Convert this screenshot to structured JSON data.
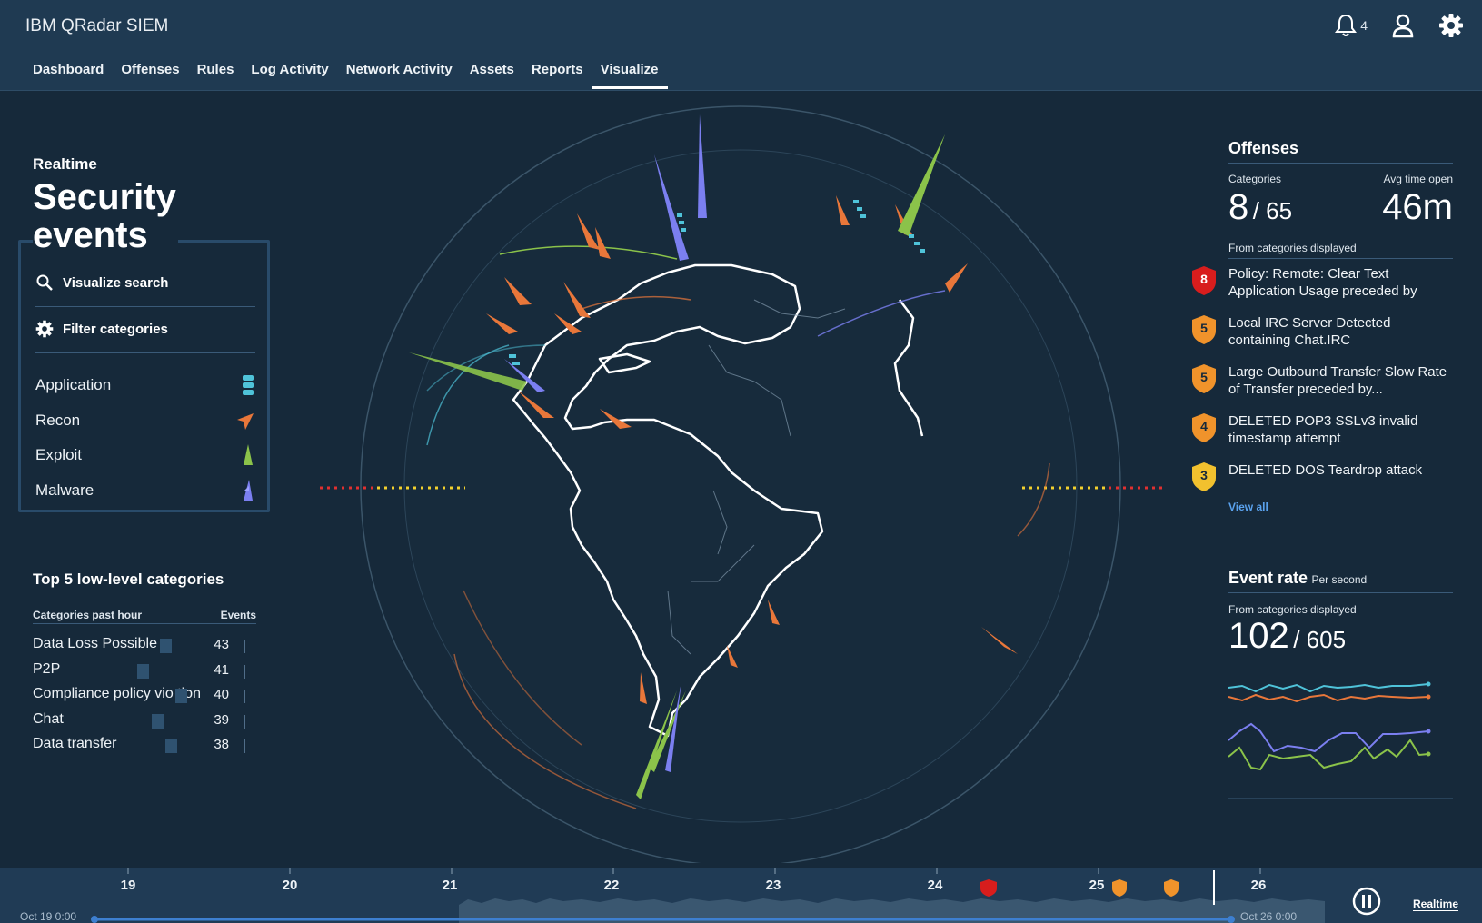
{
  "app": {
    "title": "IBM QRadar SIEM",
    "notification_count": "4"
  },
  "nav": {
    "items": [
      {
        "label": "Dashboard"
      },
      {
        "label": "Offenses"
      },
      {
        "label": "Rules"
      },
      {
        "label": "Log Activity"
      },
      {
        "label": "Network Activity"
      },
      {
        "label": "Assets"
      },
      {
        "label": "Reports"
      },
      {
        "label": "Visualize"
      }
    ],
    "active": "Visualize"
  },
  "left_panel": {
    "realtime_label": "Realtime",
    "title_line1": "Security",
    "title_line2": "events",
    "visualize_search": "Visualize search",
    "filter_categories": "Filter categories",
    "categories": [
      {
        "label": "Application",
        "icon": "application-cylinder-icon",
        "color": "#4fc3d9"
      },
      {
        "label": "Recon",
        "icon": "recon-arrow-icon",
        "color": "#e9773a"
      },
      {
        "label": "Exploit",
        "icon": "exploit-spike-icon",
        "color": "#8bc34a"
      },
      {
        "label": "Malware",
        "icon": "malware-spike-icon",
        "color": "#7b7ff0"
      }
    ]
  },
  "top5": {
    "title": "Top 5 low-level categories",
    "col_category": "Categories past hour",
    "col_events": "Events",
    "rows": [
      {
        "label": "Data Loss Possible",
        "events": "43"
      },
      {
        "label": "P2P",
        "events": "41"
      },
      {
        "label": "Compliance policy vio  tion",
        "events": "40"
      },
      {
        "label": "Chat",
        "events": "39"
      },
      {
        "label": "Data transfer",
        "events": "38"
      }
    ]
  },
  "offenses": {
    "title": "Offenses",
    "categories_label": "Categories",
    "categories_value": "8",
    "categories_total": "/ 65",
    "avg_label": "Avg time open",
    "avg_value": "46m",
    "from_label": "From categories displayed",
    "items": [
      {
        "severity": "8",
        "color": "#d81d1d",
        "text": "Policy: Remote: Clear Text Application Usage preceded by"
      },
      {
        "severity": "5",
        "color": "#f0932b",
        "text": "Local IRC Server Detected containing Chat.IRC"
      },
      {
        "severity": "5",
        "color": "#f0932b",
        "text": "Large Outbound Transfer Slow Rate of Transfer preceded by..."
      },
      {
        "severity": "4",
        "color": "#f0932b",
        "text": "DELETED POP3 SSLv3 invalid timestamp attempt"
      },
      {
        "severity": "3",
        "color": "#f2c12e",
        "text": "DELETED DOS Teardrop attack"
      }
    ],
    "view_all": "View all"
  },
  "event_rate": {
    "title": "Event rate",
    "unit": "Per second",
    "from_label": "From categories displayed",
    "value": "102",
    "total": "/ 605",
    "series_colors": [
      "#4fc3d9",
      "#e9773a",
      "#7b7ff0",
      "#8bc34a"
    ]
  },
  "timeline": {
    "days": [
      "19",
      "20",
      "21",
      "22",
      "23",
      "24",
      "25",
      "26"
    ],
    "start_date": "Oct 19 0:00",
    "end_date": "Oct 26 0:00",
    "realtime_label": "Realtime",
    "markers": [
      {
        "type": "critical",
        "color": "#d81d1d"
      },
      {
        "type": "warning",
        "color": "#f0932b"
      },
      {
        "type": "warning",
        "color": "#f0932b"
      }
    ]
  }
}
